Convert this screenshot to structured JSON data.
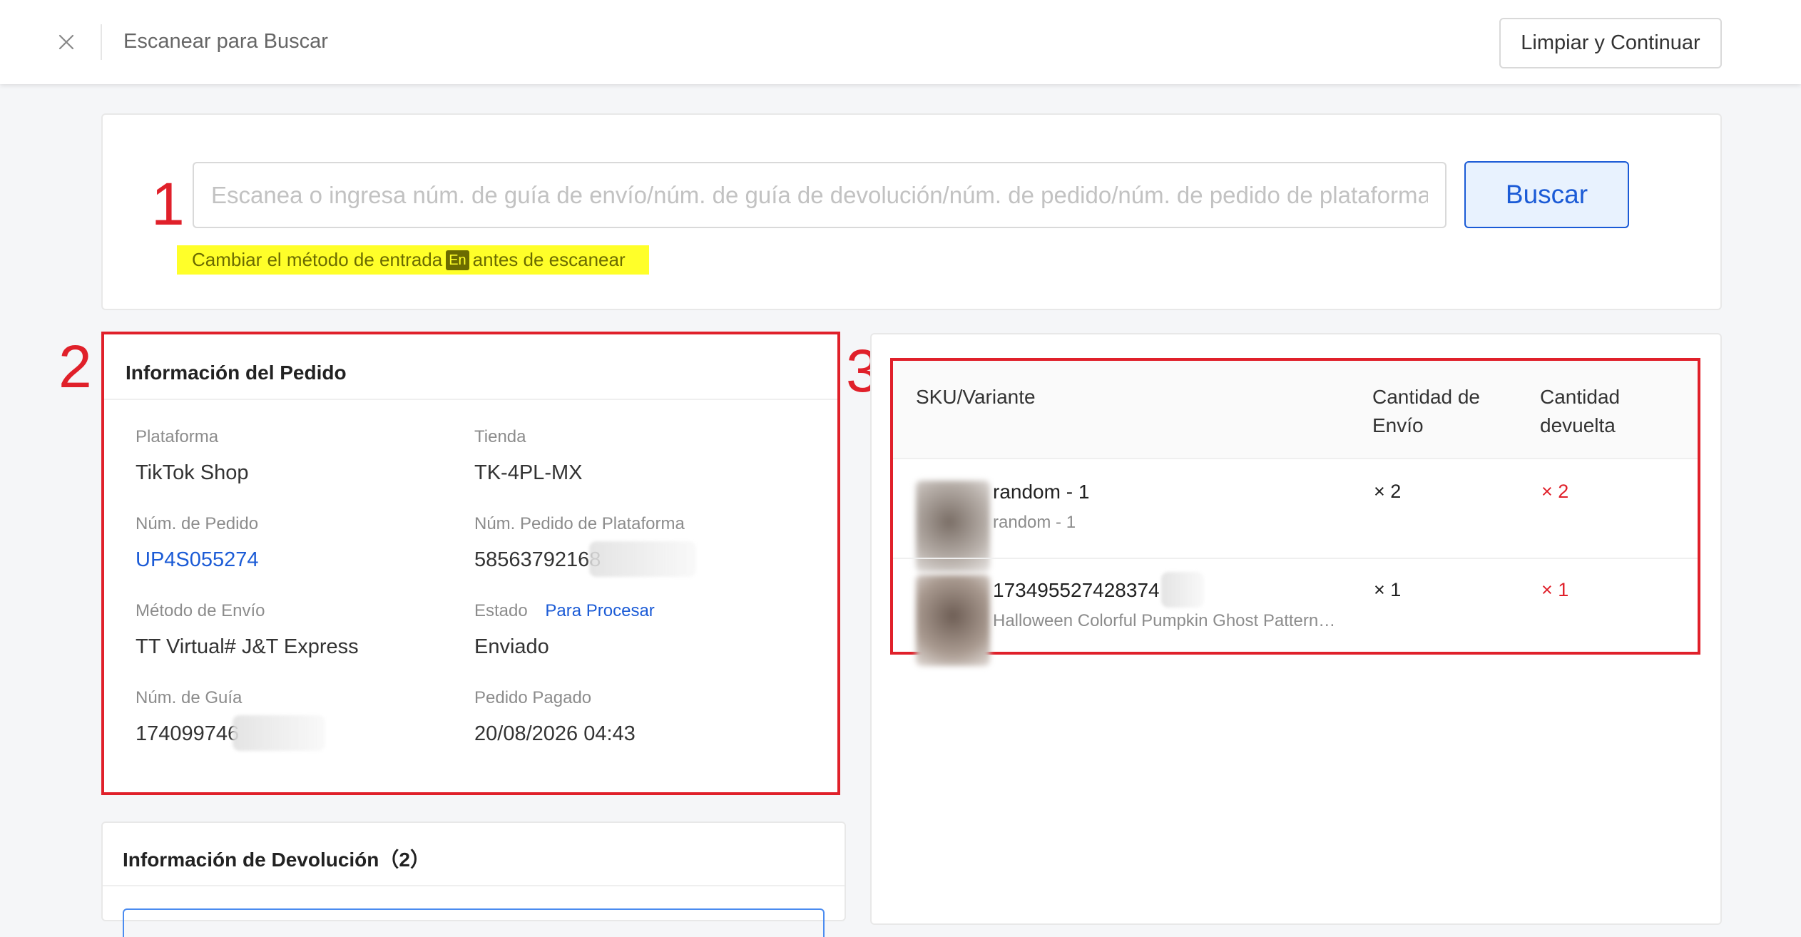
{
  "topbar": {
    "title": "Escanear para Buscar",
    "close_icon": "close-icon",
    "clear_button": "Limpiar y Continuar"
  },
  "annotations": [
    "1",
    "2",
    "3"
  ],
  "search": {
    "placeholder": "Escanea o ingresa núm. de guía de envío/núm. de guía de devolución/núm. de pedido/núm. de pedido de plataforma",
    "button": "Buscar",
    "hint_before": "Cambiar el método de entrada",
    "hint_badge": "En",
    "hint_after": "antes de escanear"
  },
  "order": {
    "title": "Información del Pedido",
    "fields": {
      "platform_label": "Plataforma",
      "platform_value": "TikTok Shop",
      "store_label": "Tienda",
      "store_value": "TK-4PL-MX",
      "order_no_label": "Núm. de Pedido",
      "order_no_value": "UP4S055274",
      "platform_order_label": "Núm. Pedido de Plataforma",
      "platform_order_value": "58563792168",
      "shipping_label": "Método de Envío",
      "shipping_value": "TT Virtual# J&T Express",
      "status_label": "Estado",
      "status_link": "Para Procesar",
      "status_value": "Enviado",
      "tracking_label": "Núm. de Guía",
      "tracking_value": "174099746",
      "paid_label": "Pedido Pagado",
      "paid_value": "20/08/2026 04:43"
    }
  },
  "returns": {
    "title": "Información de Devolución（2）"
  },
  "sku_table": {
    "headers": {
      "sku": "SKU/Variante",
      "ship_qty_line1": "Cantidad de",
      "ship_qty_line2": "Envío",
      "return_qty_line1": "Cantidad",
      "return_qty_line2": "devuelta"
    },
    "rows": [
      {
        "name": "random - 1",
        "variant": "random - 1",
        "ship_qty": "× 2",
        "return_qty": "× 2"
      },
      {
        "name": "173495527428374",
        "variant": "Halloween Colorful Pumpkin Ghost Pattern…",
        "ship_qty": "× 1",
        "return_qty": "× 1"
      }
    ]
  },
  "colors": {
    "accent": "#1b5bd6",
    "annotation_red": "#e0202a",
    "highlight": "#ffff29"
  }
}
